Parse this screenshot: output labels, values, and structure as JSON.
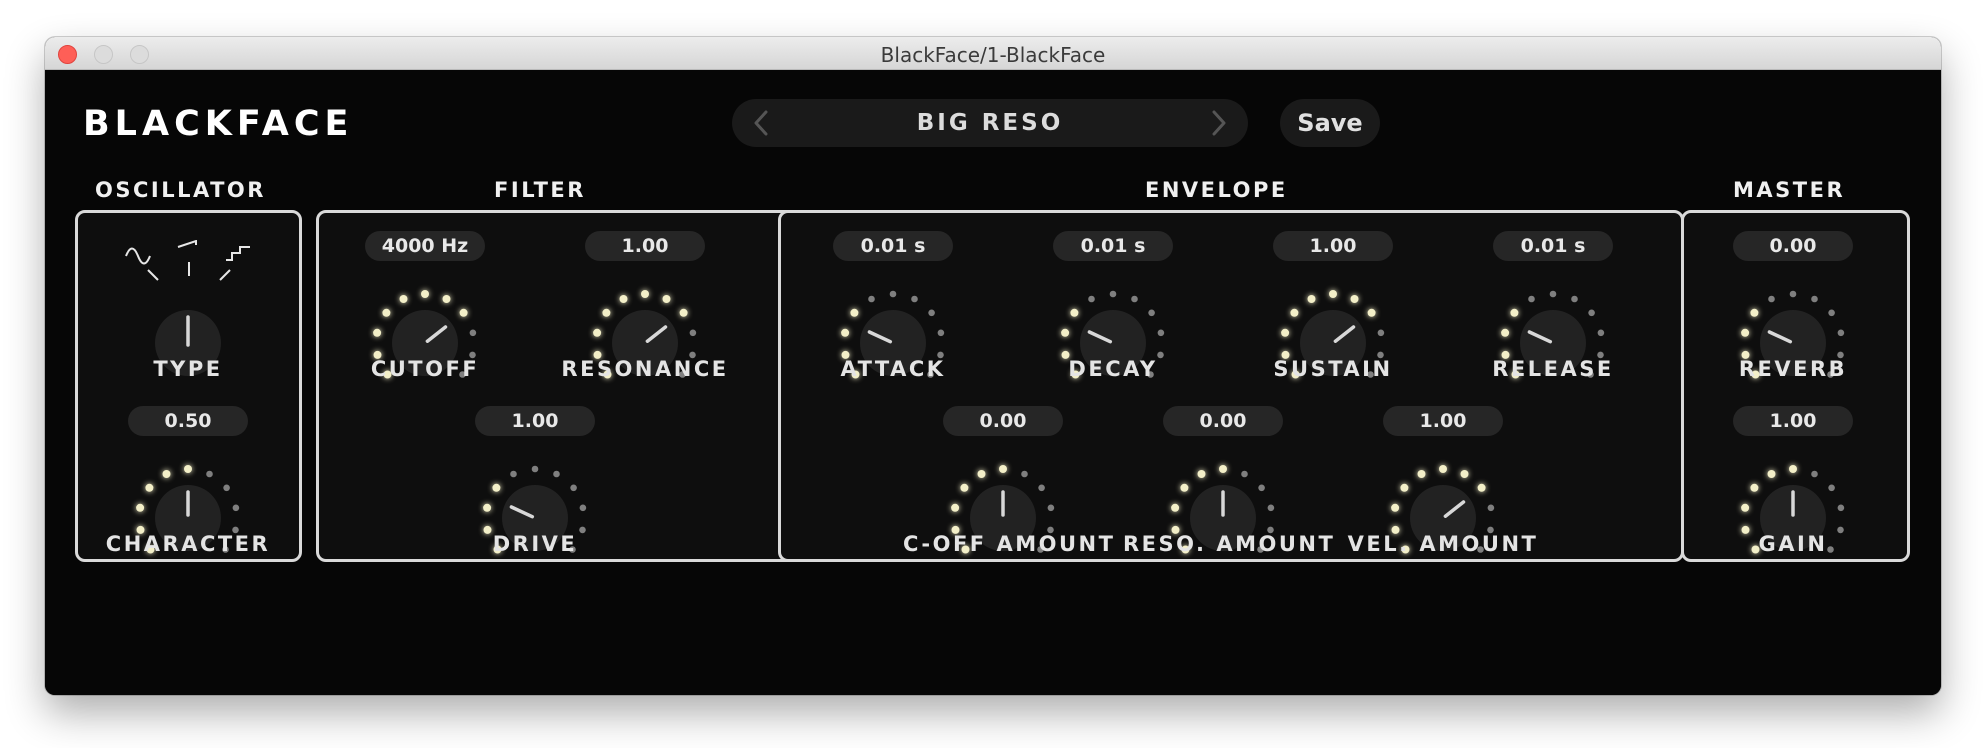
{
  "window": {
    "title": "BlackFace/1-BlackFace"
  },
  "header": {
    "logo": "BLACKFACE",
    "preset_name": "BIG RESO",
    "save_label": "Save",
    "prev_icon": "chevron-left-icon",
    "next_icon": "chevron-right-icon"
  },
  "colors": {
    "led_on": "#f3efc8",
    "led_off": "#7f7f7f",
    "panel_border": "#d9d9d9",
    "knob": "#222222"
  },
  "sections": {
    "oscillator": "OSCILLATOR",
    "filter": "FILTER",
    "envelope": "ENVELOPE",
    "master": "MASTER"
  },
  "knobs": {
    "type": {
      "label": "TYPE",
      "selected_position": 1,
      "positions": 3,
      "icons": [
        "sine-wave-icon",
        "saw-wave-icon",
        "square-wave-icon"
      ]
    },
    "character": {
      "label": "CHARACTER",
      "value": "0.50",
      "level": 0.5
    },
    "cutoff": {
      "label": "CUTOFF",
      "value": "4000 Hz",
      "level": 0.7
    },
    "resonance": {
      "label": "RESONANCE",
      "value": "1.00",
      "level": 0.7
    },
    "drive": {
      "label": "DRIVE",
      "value": "1.00",
      "level": 0.25
    },
    "attack": {
      "label": "ATTACK",
      "value": "0.01 s",
      "level": 0.25
    },
    "decay": {
      "label": "DECAY",
      "value": "0.01 s",
      "level": 0.25
    },
    "sustain": {
      "label": "SUSTAIN",
      "value": "1.00",
      "level": 0.7
    },
    "release": {
      "label": "RELEASE",
      "value": "0.01 s",
      "level": 0.25
    },
    "cutoff_amount": {
      "label": "C-OFF AMOUNT",
      "value": "0.00",
      "level": 0.5
    },
    "reso_amount": {
      "label": "RESO. AMOUNT",
      "value": "0.00",
      "level": 0.5
    },
    "vel_amount": {
      "label": "VEL. AMOUNT",
      "value": "1.00",
      "level": 0.7
    },
    "reverb": {
      "label": "REVERB",
      "value": "0.00",
      "level": 0.25
    },
    "gain": {
      "label": "GAIN",
      "value": "1.00",
      "level": 0.5
    }
  }
}
